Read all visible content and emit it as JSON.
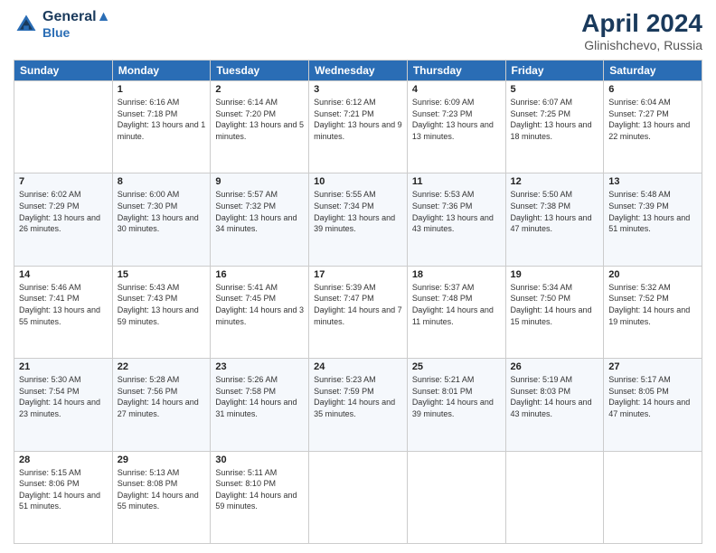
{
  "header": {
    "logo_line1": "General",
    "logo_line2": "Blue",
    "month_year": "April 2024",
    "location": "Glinishchevo, Russia"
  },
  "weekdays": [
    "Sunday",
    "Monday",
    "Tuesday",
    "Wednesday",
    "Thursday",
    "Friday",
    "Saturday"
  ],
  "weeks": [
    [
      {
        "day": "",
        "sunrise": "",
        "sunset": "",
        "daylight": ""
      },
      {
        "day": "1",
        "sunrise": "Sunrise: 6:16 AM",
        "sunset": "Sunset: 7:18 PM",
        "daylight": "Daylight: 13 hours and 1 minute."
      },
      {
        "day": "2",
        "sunrise": "Sunrise: 6:14 AM",
        "sunset": "Sunset: 7:20 PM",
        "daylight": "Daylight: 13 hours and 5 minutes."
      },
      {
        "day": "3",
        "sunrise": "Sunrise: 6:12 AM",
        "sunset": "Sunset: 7:21 PM",
        "daylight": "Daylight: 13 hours and 9 minutes."
      },
      {
        "day": "4",
        "sunrise": "Sunrise: 6:09 AM",
        "sunset": "Sunset: 7:23 PM",
        "daylight": "Daylight: 13 hours and 13 minutes."
      },
      {
        "day": "5",
        "sunrise": "Sunrise: 6:07 AM",
        "sunset": "Sunset: 7:25 PM",
        "daylight": "Daylight: 13 hours and 18 minutes."
      },
      {
        "day": "6",
        "sunrise": "Sunrise: 6:04 AM",
        "sunset": "Sunset: 7:27 PM",
        "daylight": "Daylight: 13 hours and 22 minutes."
      }
    ],
    [
      {
        "day": "7",
        "sunrise": "Sunrise: 6:02 AM",
        "sunset": "Sunset: 7:29 PM",
        "daylight": "Daylight: 13 hours and 26 minutes."
      },
      {
        "day": "8",
        "sunrise": "Sunrise: 6:00 AM",
        "sunset": "Sunset: 7:30 PM",
        "daylight": "Daylight: 13 hours and 30 minutes."
      },
      {
        "day": "9",
        "sunrise": "Sunrise: 5:57 AM",
        "sunset": "Sunset: 7:32 PM",
        "daylight": "Daylight: 13 hours and 34 minutes."
      },
      {
        "day": "10",
        "sunrise": "Sunrise: 5:55 AM",
        "sunset": "Sunset: 7:34 PM",
        "daylight": "Daylight: 13 hours and 39 minutes."
      },
      {
        "day": "11",
        "sunrise": "Sunrise: 5:53 AM",
        "sunset": "Sunset: 7:36 PM",
        "daylight": "Daylight: 13 hours and 43 minutes."
      },
      {
        "day": "12",
        "sunrise": "Sunrise: 5:50 AM",
        "sunset": "Sunset: 7:38 PM",
        "daylight": "Daylight: 13 hours and 47 minutes."
      },
      {
        "day": "13",
        "sunrise": "Sunrise: 5:48 AM",
        "sunset": "Sunset: 7:39 PM",
        "daylight": "Daylight: 13 hours and 51 minutes."
      }
    ],
    [
      {
        "day": "14",
        "sunrise": "Sunrise: 5:46 AM",
        "sunset": "Sunset: 7:41 PM",
        "daylight": "Daylight: 13 hours and 55 minutes."
      },
      {
        "day": "15",
        "sunrise": "Sunrise: 5:43 AM",
        "sunset": "Sunset: 7:43 PM",
        "daylight": "Daylight: 13 hours and 59 minutes."
      },
      {
        "day": "16",
        "sunrise": "Sunrise: 5:41 AM",
        "sunset": "Sunset: 7:45 PM",
        "daylight": "Daylight: 14 hours and 3 minutes."
      },
      {
        "day": "17",
        "sunrise": "Sunrise: 5:39 AM",
        "sunset": "Sunset: 7:47 PM",
        "daylight": "Daylight: 14 hours and 7 minutes."
      },
      {
        "day": "18",
        "sunrise": "Sunrise: 5:37 AM",
        "sunset": "Sunset: 7:48 PM",
        "daylight": "Daylight: 14 hours and 11 minutes."
      },
      {
        "day": "19",
        "sunrise": "Sunrise: 5:34 AM",
        "sunset": "Sunset: 7:50 PM",
        "daylight": "Daylight: 14 hours and 15 minutes."
      },
      {
        "day": "20",
        "sunrise": "Sunrise: 5:32 AM",
        "sunset": "Sunset: 7:52 PM",
        "daylight": "Daylight: 14 hours and 19 minutes."
      }
    ],
    [
      {
        "day": "21",
        "sunrise": "Sunrise: 5:30 AM",
        "sunset": "Sunset: 7:54 PM",
        "daylight": "Daylight: 14 hours and 23 minutes."
      },
      {
        "day": "22",
        "sunrise": "Sunrise: 5:28 AM",
        "sunset": "Sunset: 7:56 PM",
        "daylight": "Daylight: 14 hours and 27 minutes."
      },
      {
        "day": "23",
        "sunrise": "Sunrise: 5:26 AM",
        "sunset": "Sunset: 7:58 PM",
        "daylight": "Daylight: 14 hours and 31 minutes."
      },
      {
        "day": "24",
        "sunrise": "Sunrise: 5:23 AM",
        "sunset": "Sunset: 7:59 PM",
        "daylight": "Daylight: 14 hours and 35 minutes."
      },
      {
        "day": "25",
        "sunrise": "Sunrise: 5:21 AM",
        "sunset": "Sunset: 8:01 PM",
        "daylight": "Daylight: 14 hours and 39 minutes."
      },
      {
        "day": "26",
        "sunrise": "Sunrise: 5:19 AM",
        "sunset": "Sunset: 8:03 PM",
        "daylight": "Daylight: 14 hours and 43 minutes."
      },
      {
        "day": "27",
        "sunrise": "Sunrise: 5:17 AM",
        "sunset": "Sunset: 8:05 PM",
        "daylight": "Daylight: 14 hours and 47 minutes."
      }
    ],
    [
      {
        "day": "28",
        "sunrise": "Sunrise: 5:15 AM",
        "sunset": "Sunset: 8:06 PM",
        "daylight": "Daylight: 14 hours and 51 minutes."
      },
      {
        "day": "29",
        "sunrise": "Sunrise: 5:13 AM",
        "sunset": "Sunset: 8:08 PM",
        "daylight": "Daylight: 14 hours and 55 minutes."
      },
      {
        "day": "30",
        "sunrise": "Sunrise: 5:11 AM",
        "sunset": "Sunset: 8:10 PM",
        "daylight": "Daylight: 14 hours and 59 minutes."
      },
      {
        "day": "",
        "sunrise": "",
        "sunset": "",
        "daylight": ""
      },
      {
        "day": "",
        "sunrise": "",
        "sunset": "",
        "daylight": ""
      },
      {
        "day": "",
        "sunrise": "",
        "sunset": "",
        "daylight": ""
      },
      {
        "day": "",
        "sunrise": "",
        "sunset": "",
        "daylight": ""
      }
    ]
  ]
}
